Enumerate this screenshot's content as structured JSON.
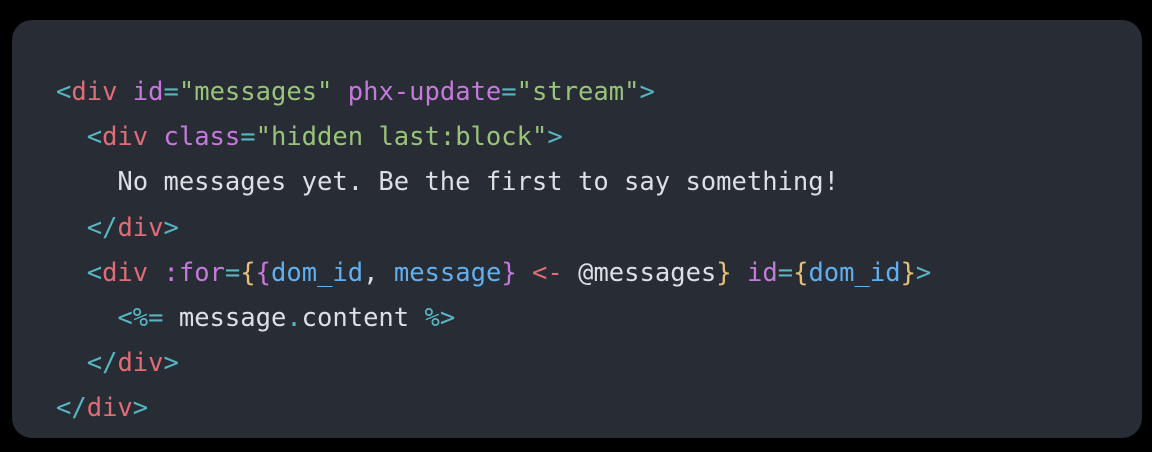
{
  "colors": {
    "background": "#000000",
    "card": "#282c34",
    "punct": "#56b6c2",
    "tag": "#e06c75",
    "attr": "#c678dd",
    "string": "#98c379",
    "plain": "#dcdfe4",
    "brace": "#e5c07b",
    "variable": "#61afef",
    "arrow": "#e06c75"
  },
  "code_lines": [
    [
      {
        "text": "<",
        "role": "punct"
      },
      {
        "text": "div",
        "role": "tag"
      },
      {
        "text": " ",
        "role": "plain"
      },
      {
        "text": "id",
        "role": "attr"
      },
      {
        "text": "=",
        "role": "punct"
      },
      {
        "text": "\"messages\"",
        "role": "string"
      },
      {
        "text": " ",
        "role": "plain"
      },
      {
        "text": "phx-update",
        "role": "attr"
      },
      {
        "text": "=",
        "role": "punct"
      },
      {
        "text": "\"stream\"",
        "role": "string"
      },
      {
        "text": ">",
        "role": "punct"
      }
    ],
    [
      {
        "text": "  ",
        "role": "plain"
      },
      {
        "text": "<",
        "role": "punct"
      },
      {
        "text": "div",
        "role": "tag"
      },
      {
        "text": " ",
        "role": "plain"
      },
      {
        "text": "class",
        "role": "attr"
      },
      {
        "text": "=",
        "role": "punct"
      },
      {
        "text": "\"hidden last:block\"",
        "role": "string"
      },
      {
        "text": ">",
        "role": "punct"
      }
    ],
    [
      {
        "text": "    No messages yet. Be the first to say something!",
        "role": "plain"
      }
    ],
    [
      {
        "text": "  ",
        "role": "plain"
      },
      {
        "text": "</",
        "role": "punct"
      },
      {
        "text": "div",
        "role": "tag"
      },
      {
        "text": ">",
        "role": "punct"
      }
    ],
    [
      {
        "text": "  ",
        "role": "plain"
      },
      {
        "text": "<",
        "role": "punct"
      },
      {
        "text": "div",
        "role": "tag"
      },
      {
        "text": " ",
        "role": "plain"
      },
      {
        "text": ":for",
        "role": "attr"
      },
      {
        "text": "=",
        "role": "punct"
      },
      {
        "text": "{",
        "role": "brace"
      },
      {
        "text": "{",
        "role": "attr"
      },
      {
        "text": "dom_id",
        "role": "variable"
      },
      {
        "text": ", ",
        "role": "plain"
      },
      {
        "text": "message",
        "role": "variable"
      },
      {
        "text": "}",
        "role": "attr"
      },
      {
        "text": " ",
        "role": "plain"
      },
      {
        "text": "<-",
        "role": "arrow"
      },
      {
        "text": " @messages",
        "role": "plain"
      },
      {
        "text": "}",
        "role": "brace"
      },
      {
        "text": " ",
        "role": "plain"
      },
      {
        "text": "id",
        "role": "attr"
      },
      {
        "text": "=",
        "role": "punct"
      },
      {
        "text": "{",
        "role": "brace"
      },
      {
        "text": "dom_id",
        "role": "variable"
      },
      {
        "text": "}",
        "role": "brace"
      },
      {
        "text": ">",
        "role": "punct"
      }
    ],
    [
      {
        "text": "    ",
        "role": "plain"
      },
      {
        "text": "<%=",
        "role": "punct"
      },
      {
        "text": " message",
        "role": "plain"
      },
      {
        "text": ".",
        "role": "punct"
      },
      {
        "text": "content ",
        "role": "plain"
      },
      {
        "text": "%>",
        "role": "punct"
      }
    ],
    [
      {
        "text": "  ",
        "role": "plain"
      },
      {
        "text": "</",
        "role": "punct"
      },
      {
        "text": "div",
        "role": "tag"
      },
      {
        "text": ">",
        "role": "punct"
      }
    ],
    [
      {
        "text": "</",
        "role": "punct"
      },
      {
        "text": "div",
        "role": "tag"
      },
      {
        "text": ">",
        "role": "punct"
      }
    ]
  ]
}
